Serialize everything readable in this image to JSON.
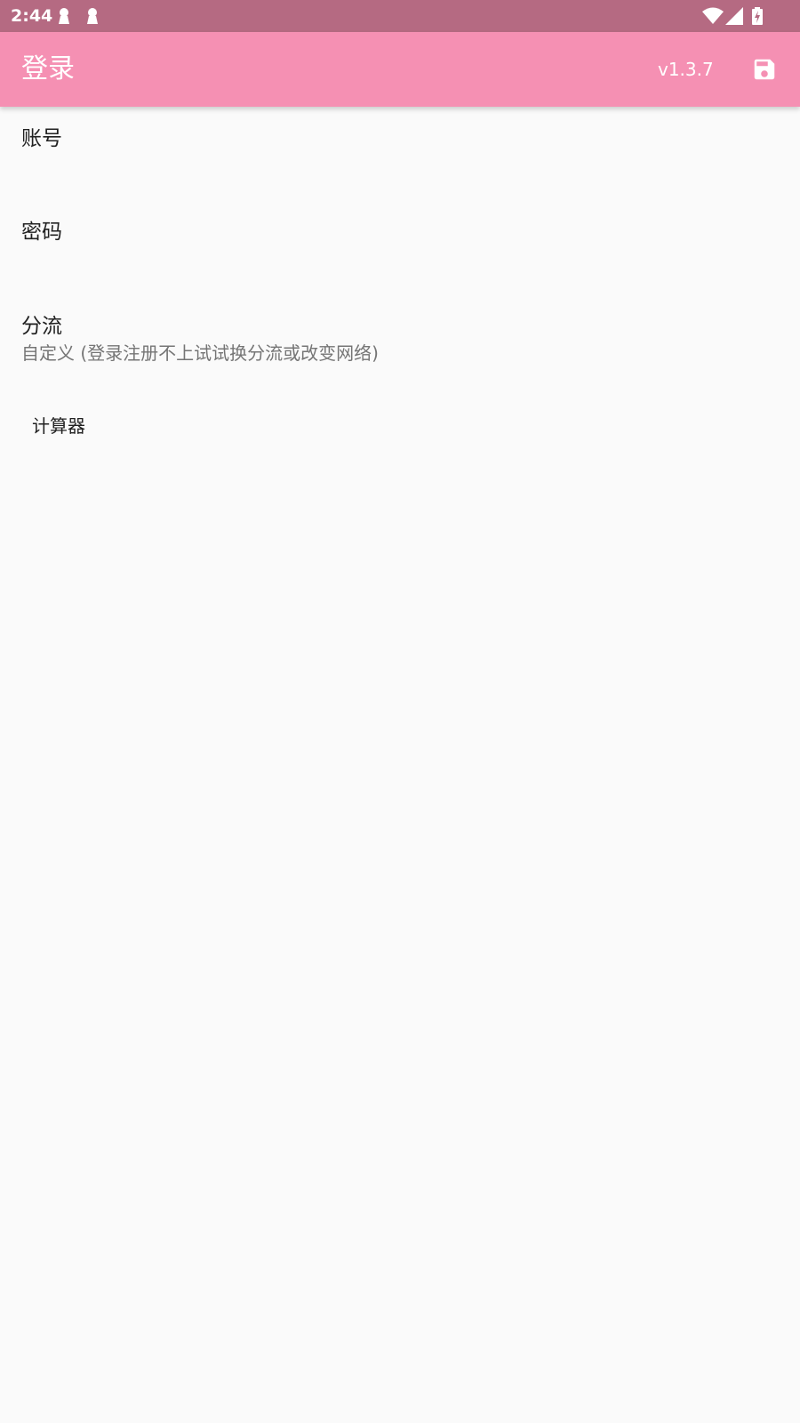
{
  "status_bar": {
    "time": "2:44",
    "icons_left": [
      "notification-icon",
      "notification-icon"
    ],
    "icons_right": [
      "wifi-icon",
      "signal-icon",
      "battery-charging-icon"
    ]
  },
  "app_bar": {
    "title": "登录",
    "version": "v1.3.7",
    "action_icon": "save-icon",
    "background": "#f590b3"
  },
  "preferences": {
    "account": {
      "title": "账号"
    },
    "password": {
      "title": "密码"
    },
    "route": {
      "title": "分流",
      "summary": "自定义 (登录注册不上试试换分流或改变网络)"
    }
  },
  "calculator_button": {
    "label": "计算器"
  },
  "colors": {
    "status_bar": "#b56a82",
    "app_bar": "#f590b3",
    "background": "#fafafa",
    "text_primary": "#212121",
    "text_secondary": "#757575"
  }
}
